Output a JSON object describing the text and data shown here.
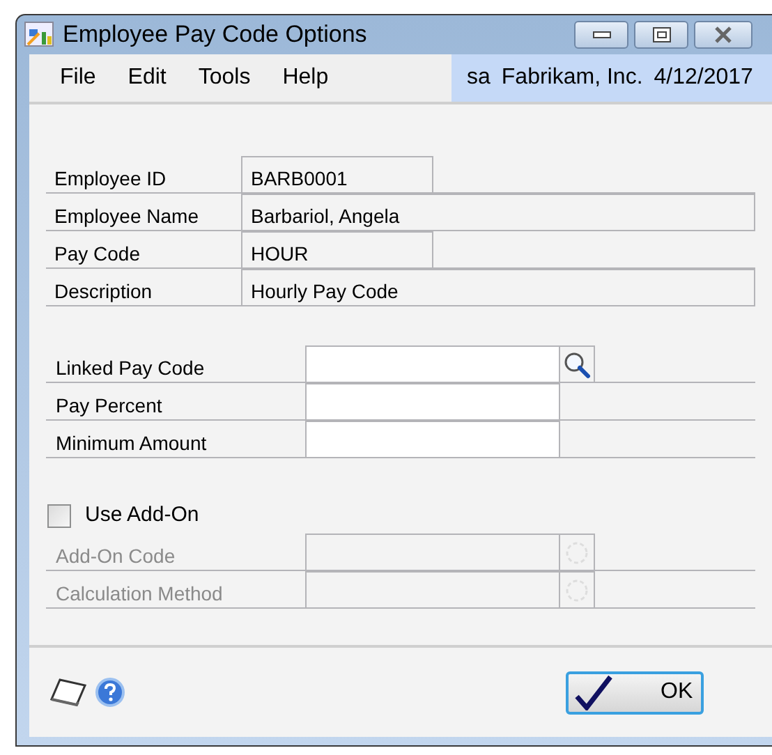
{
  "window": {
    "title": "Employee Pay Code Options"
  },
  "menu": [
    "File",
    "Edit",
    "Tools",
    "Help"
  ],
  "session": {
    "user": "sa",
    "company": "Fabrikam, Inc.",
    "date": "4/12/2017"
  },
  "info_fields": [
    {
      "label": "Employee ID",
      "value": "BARB0001",
      "wide": false
    },
    {
      "label": "Employee Name",
      "value": "Barbariol, Angela",
      "wide": true
    },
    {
      "label": "Pay Code",
      "value": "HOUR",
      "wide": false
    },
    {
      "label": "Description",
      "value": "Hourly Pay Code",
      "wide": true
    }
  ],
  "entry_fields": [
    {
      "label": "Linked Pay Code",
      "lookup": true,
      "disabled": false
    },
    {
      "label": "Pay Percent",
      "lookup": false,
      "disabled": false
    },
    {
      "label": "Minimum Amount",
      "lookup": false,
      "disabled": false
    }
  ],
  "use_addon": {
    "label": "Use Add-On",
    "checked": false
  },
  "addon_fields": [
    {
      "label": "Add-On Code",
      "lookup": true,
      "disabled": true
    },
    {
      "label": "Calculation Method",
      "lookup": true,
      "disabled": true
    }
  ],
  "ok_button": "OK"
}
